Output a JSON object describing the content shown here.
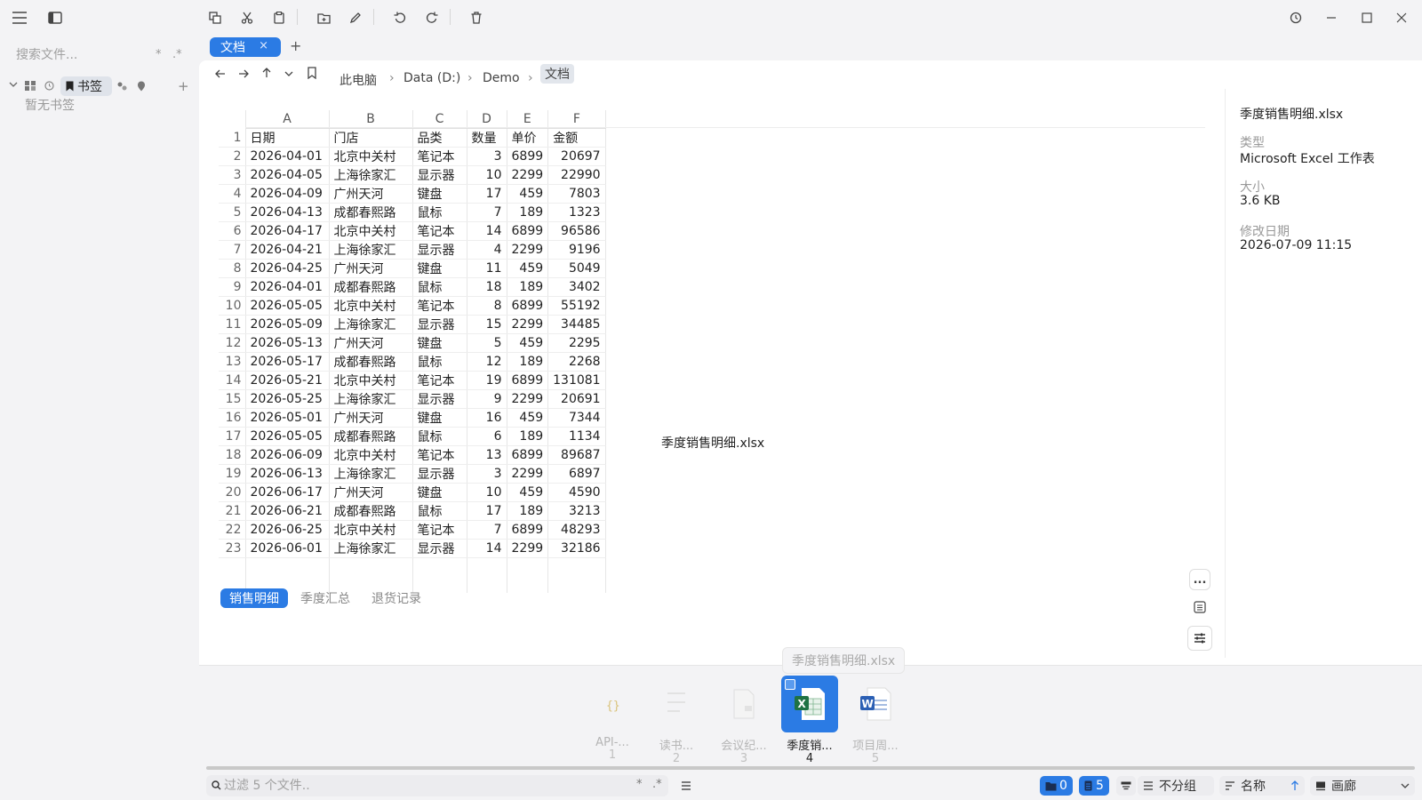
{
  "left_panel": {
    "search_placeholder": "搜索文件...",
    "search_opt1": "*",
    "search_opt2": ".*",
    "bookmarks_label": "书签",
    "empty_bookmarks": "暂无书签",
    "add": "+"
  },
  "tab": {
    "label": "文档",
    "close": "×",
    "new": "+"
  },
  "breadcrumb": [
    "此电脑",
    "Data (D:)",
    "Demo",
    "文档"
  ],
  "breadcrumb_sep": "›",
  "sheet": {
    "col_letters": [
      "A",
      "B",
      "C",
      "D",
      "E",
      "F"
    ],
    "rows": [
      [
        "1",
        "日期",
        "门店",
        "品类",
        "数量",
        "单价",
        "金额"
      ],
      [
        "2",
        "2026-04-01",
        "北京中关村",
        "笔记本",
        "3",
        "6899",
        "20697"
      ],
      [
        "3",
        "2026-04-05",
        "上海徐家汇",
        "显示器",
        "10",
        "2299",
        "22990"
      ],
      [
        "4",
        "2026-04-09",
        "广州天河",
        "键盘",
        "17",
        "459",
        "7803"
      ],
      [
        "5",
        "2026-04-13",
        "成都春熙路",
        "鼠标",
        "7",
        "189",
        "1323"
      ],
      [
        "6",
        "2026-04-17",
        "北京中关村",
        "笔记本",
        "14",
        "6899",
        "96586"
      ],
      [
        "7",
        "2026-04-21",
        "上海徐家汇",
        "显示器",
        "4",
        "2299",
        "9196"
      ],
      [
        "8",
        "2026-04-25",
        "广州天河",
        "键盘",
        "11",
        "459",
        "5049"
      ],
      [
        "9",
        "2026-04-01",
        "成都春熙路",
        "鼠标",
        "18",
        "189",
        "3402"
      ],
      [
        "10",
        "2026-05-05",
        "北京中关村",
        "笔记本",
        "8",
        "6899",
        "55192"
      ],
      [
        "11",
        "2026-05-09",
        "上海徐家汇",
        "显示器",
        "15",
        "2299",
        "34485"
      ],
      [
        "12",
        "2026-05-13",
        "广州天河",
        "键盘",
        "5",
        "459",
        "2295"
      ],
      [
        "13",
        "2026-05-17",
        "成都春熙路",
        "鼠标",
        "12",
        "189",
        "2268"
      ],
      [
        "14",
        "2026-05-21",
        "北京中关村",
        "笔记本",
        "19",
        "6899",
        "131081"
      ],
      [
        "15",
        "2026-05-25",
        "上海徐家汇",
        "显示器",
        "9",
        "2299",
        "20691"
      ],
      [
        "16",
        "2026-05-01",
        "广州天河",
        "键盘",
        "16",
        "459",
        "7344"
      ],
      [
        "17",
        "2026-05-05",
        "成都春熙路",
        "鼠标",
        "6",
        "189",
        "1134"
      ],
      [
        "18",
        "2026-06-09",
        "北京中关村",
        "笔记本",
        "13",
        "6899",
        "89687"
      ],
      [
        "19",
        "2026-06-13",
        "上海徐家汇",
        "显示器",
        "3",
        "2299",
        "6897"
      ],
      [
        "20",
        "2026-06-17",
        "广州天河",
        "键盘",
        "10",
        "459",
        "4590"
      ],
      [
        "21",
        "2026-06-21",
        "成都春熙路",
        "鼠标",
        "17",
        "189",
        "3213"
      ],
      [
        "22",
        "2026-06-25",
        "北京中关村",
        "笔记本",
        "7",
        "6899",
        "48293"
      ],
      [
        "23",
        "2026-06-01",
        "上海徐家汇",
        "显示器",
        "14",
        "2299",
        "32186"
      ]
    ],
    "tabs": [
      "销售明细",
      "季度汇总",
      "退货记录"
    ]
  },
  "preview_caption": "季度销售明细.xlsx",
  "details": {
    "filename": "季度销售明细.xlsx",
    "type_label": "类型",
    "type_value": "Microsoft Excel 工作表",
    "size_label": "大小",
    "size_value": "3.6 KB",
    "date_label": "修改日期",
    "date_value": "2026-07-09 11:15"
  },
  "more_label": "...",
  "gallery": {
    "tooltip": "季度销售明细.xlsx",
    "items": [
      {
        "name": "API-...",
        "num": "1",
        "icon": "json-file-icon"
      },
      {
        "name": "读书...",
        "num": "2",
        "icon": "text-file-icon"
      },
      {
        "name": "会议纪...",
        "num": "3",
        "icon": "document-file-icon"
      },
      {
        "name": "季度销...",
        "num": "4",
        "icon": "excel-file-icon"
      },
      {
        "name": "项目周...",
        "num": "5",
        "icon": "word-file-icon"
      }
    ]
  },
  "status": {
    "filter_placeholder": "过滤 5 个文件..",
    "filter_opt1": "*",
    "filter_opt2": ".*",
    "folders_count": "0",
    "files_count": "5",
    "group_label": "不分组",
    "sort_label": "名称",
    "view_label": "画廊"
  },
  "colors": {
    "accent": "#2b7be4",
    "excel_green": "#1f7244",
    "word_blue": "#2b5fb4"
  }
}
